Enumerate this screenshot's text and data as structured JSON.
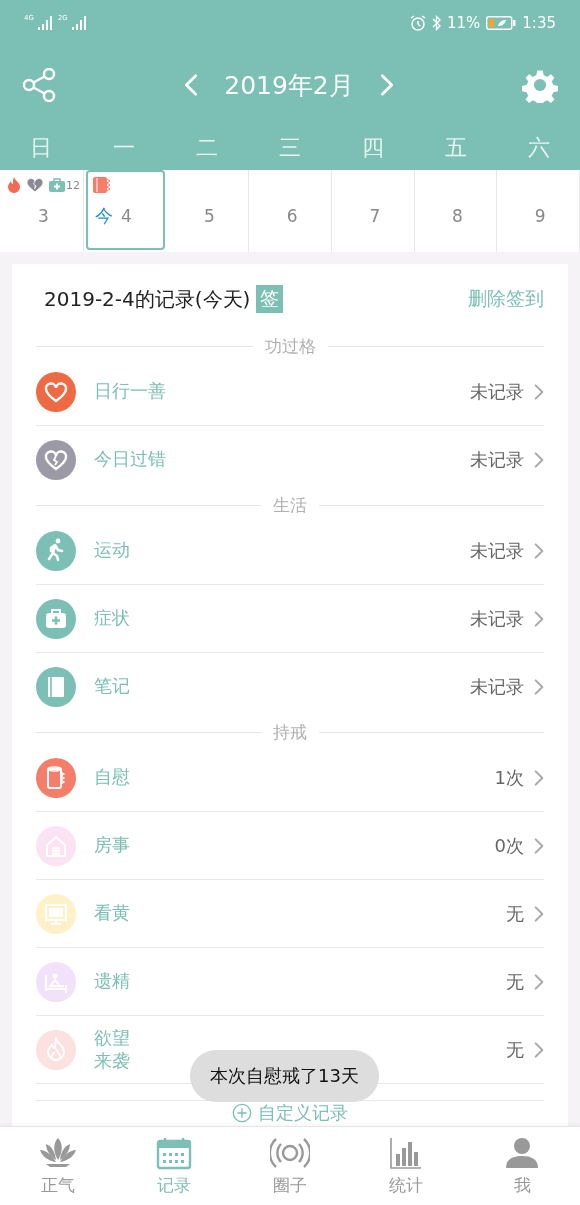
{
  "status_bar": {
    "network_1": "4G",
    "network_2": "2G",
    "battery": "11%",
    "time": "1:35"
  },
  "header": {
    "title": "2019年2月"
  },
  "weekdays": [
    "日",
    "一",
    "二",
    "三",
    "四",
    "五",
    "六"
  ],
  "days": [
    {
      "day": "3",
      "selected": false,
      "badges": [
        {
          "kind": "fire"
        },
        {
          "kind": "broken-heart"
        },
        {
          "kind": "medkit",
          "count": "12"
        }
      ]
    },
    {
      "day": "4",
      "selected": true,
      "today_label": "今",
      "badges": [
        {
          "kind": "paper-roll"
        }
      ]
    },
    {
      "day": "5",
      "selected": false
    },
    {
      "day": "6",
      "selected": false
    },
    {
      "day": "7",
      "selected": false
    },
    {
      "day": "8",
      "selected": false
    },
    {
      "day": "9",
      "selected": false
    }
  ],
  "card": {
    "title": "2019-2-4的记录(今天)",
    "sign_badge": "签",
    "action": "删除签到",
    "sections": [
      {
        "title": "功过格",
        "items": [
          {
            "label": "日行一善",
            "value": "未记录",
            "color": "#ee6a44"
          },
          {
            "label": "今日过错",
            "value": "未记录",
            "color": "#9b9aa6"
          }
        ]
      },
      {
        "title": "生活",
        "items": [
          {
            "label": "运动",
            "value": "未记录",
            "color": "#7bbfb5"
          },
          {
            "label": "症状",
            "value": "未记录",
            "color": "#7bbfb5"
          },
          {
            "label": "笔记",
            "value": "未记录",
            "color": "#7bbfb5"
          }
        ]
      },
      {
        "title": "持戒",
        "items": [
          {
            "label": "自慰",
            "value": "1次",
            "color": "#f47e69"
          },
          {
            "label": "房事",
            "value": "0次",
            "color": "#fce3f3"
          },
          {
            "label": "看黄",
            "value": "无",
            "color": "#fdf1c8"
          },
          {
            "label": "遗精",
            "value": "无",
            "color": "#f1e2f9"
          },
          {
            "label_lines": [
              "欲望",
              "来袭"
            ],
            "value": "无",
            "color": "#fde0e0"
          }
        ]
      }
    ],
    "custom_button": "自定义记录"
  },
  "toast": "本次自慰戒了13天",
  "tabs": [
    {
      "label": "正气",
      "selected": false
    },
    {
      "label": "记录",
      "selected": true
    },
    {
      "label": "圈子",
      "selected": false
    },
    {
      "label": "统计",
      "selected": false
    },
    {
      "label": "我",
      "selected": false
    }
  ]
}
